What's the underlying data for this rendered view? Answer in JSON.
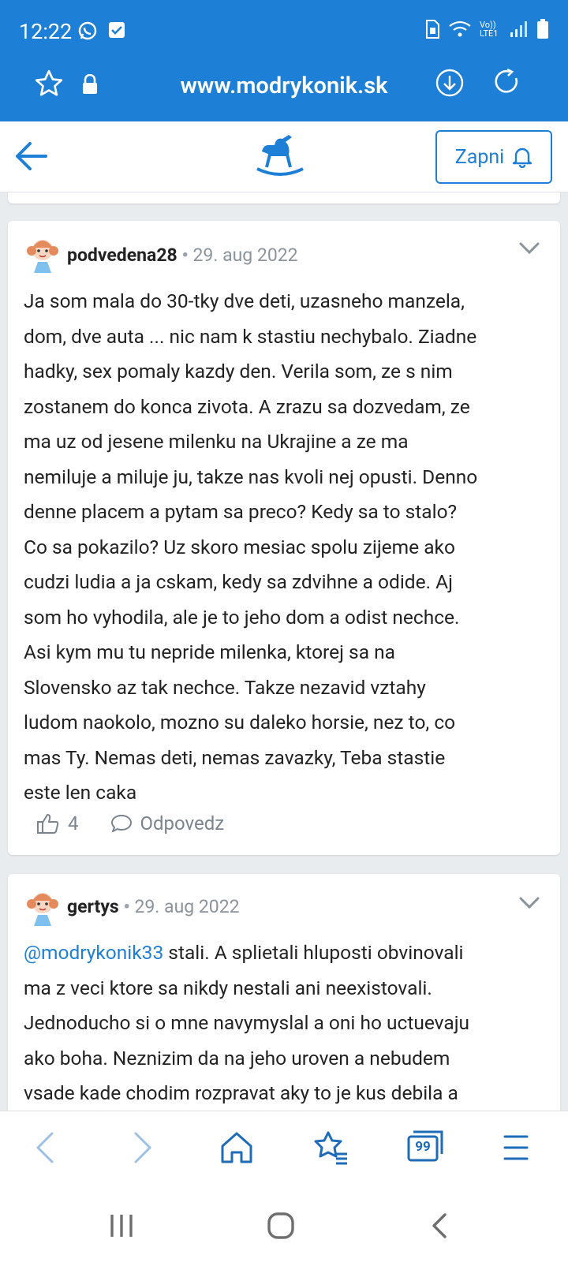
{
  "status_bar": {
    "time": "12:22",
    "network_label": "Vo)) LTE1"
  },
  "browser": {
    "url": "www.modrykonik.sk",
    "icons": [
      "star-outline-icon",
      "lock-icon",
      "download-icon",
      "reload-icon"
    ]
  },
  "site_header": {
    "subscribe_label": "Zapni"
  },
  "comments": [
    {
      "author": "podvedena28",
      "date": "29. aug 2022",
      "lines": [
        "Ja som mala do 30-tky dve deti, uzasneho manzela,",
        "dom, dve auta ... nic nam k stastiu nechybalo. Ziadne",
        "hadky, sex pomaly kazdy den. Verila som, ze s nim",
        "zostanem do konca zivota. A zrazu sa dozvedam, ze",
        "ma uz od jesene milenku na Ukrajine a ze ma",
        "nemiluje a miluje ju, takze nas kvoli nej opusti. Denno",
        "denne placem a pytam sa preco? Kedy sa to stalo?",
        "Co sa pokazilo? Uz skoro mesiac spolu zijeme ako",
        "cudzi ludia a ja cskam, kedy sa zdvihne a odide. Aj",
        "som ho vyhodila, ale je to jeho dom a odist nechce.",
        "Asi kym mu tu nepride milenka, ktorej sa na",
        "Slovensko az tak nechce. Takze nezavid vztahy",
        "ludom naokolo, mozno su daleko horsie, nez to, co",
        "mas Ty. Nemas deti, nemas zavazky, Teba stastie",
        "este len caka"
      ],
      "likes": "4",
      "reply_label": "Odpovedz"
    },
    {
      "author": "gertys",
      "date": "29. aug 2022",
      "mention": "@modrykonik33",
      "first_line_rest": " stali. A splietali hluposti obvinovali",
      "lines": [
        "ma z veci ktore sa nikdy nestali ani neexistovali.",
        "Jednoducho si o mne navymyslal a oni ho uctuevaju",
        "ako boha. Neznizim da na jeho uroven a nebudem",
        "vsade kade chodim rozpravat aky to je kus debila a"
      ]
    }
  ],
  "bottom_nav": [
    "back-icon",
    "forward-icon",
    "home-icon",
    "bookmarks-icon",
    "tabs-icon",
    "menu-icon"
  ],
  "tabs_count": "99",
  "colors": {
    "brand_blue": "#1e7fd6",
    "background": "#e9ecef",
    "muted_text": "#8b949c"
  }
}
